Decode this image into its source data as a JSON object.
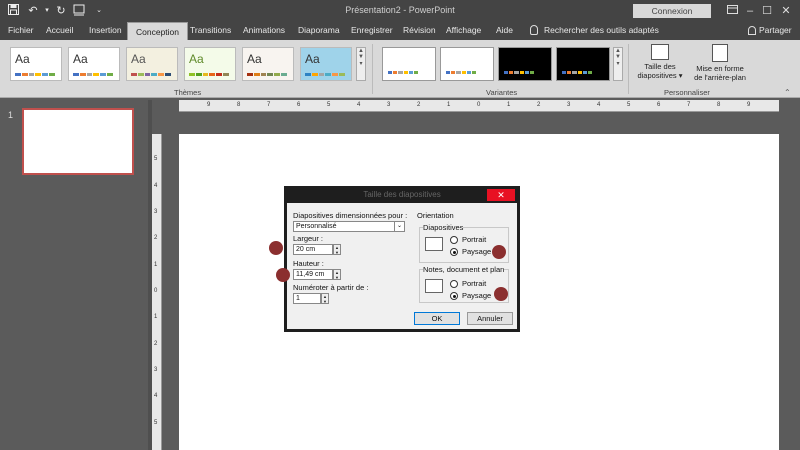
{
  "titlebar": {
    "title": "Présentation2  -  PowerPoint",
    "connexion": "Connexion",
    "icons": [
      "save-icon",
      "undo-icon",
      "redo-icon",
      "touch-mode-icon",
      "customize-icon"
    ],
    "window_controls": [
      "ribbon-display-icon",
      "minimize-icon",
      "restore-icon",
      "close-icon"
    ]
  },
  "tabs": [
    {
      "label": "Fichier",
      "active": false
    },
    {
      "label": "Accueil",
      "active": false
    },
    {
      "label": "Insertion",
      "active": false
    },
    {
      "label": "Conception",
      "active": true
    },
    {
      "label": "Transitions",
      "active": false
    },
    {
      "label": "Animations",
      "active": false
    },
    {
      "label": "Diaporama",
      "active": false
    },
    {
      "label": "Enregistrer",
      "active": false
    },
    {
      "label": "Révision",
      "active": false
    },
    {
      "label": "Affichage",
      "active": false
    },
    {
      "label": "Aide",
      "active": false
    }
  ],
  "search": {
    "label": "Rechercher des outils adaptés",
    "icon": "lightbulb-icon"
  },
  "share": {
    "label": "Partager",
    "icon": "person-icon"
  },
  "ribbon": {
    "themes": {
      "label": "Thèmes",
      "items": [
        {
          "sample": "Aa",
          "bg": "#ffffff",
          "text": "#333333",
          "bars": [
            "#4472c4",
            "#ed7d31",
            "#a5a5a5",
            "#ffc000",
            "#5b9bd5",
            "#70ad47"
          ]
        },
        {
          "sample": "Aa",
          "bg": "#ffffff",
          "text": "#333333",
          "bars": [
            "#4472c4",
            "#ed7d31",
            "#a5a5a5",
            "#ffc000",
            "#5b9bd5",
            "#70ad47"
          ]
        },
        {
          "sample": "Aa",
          "bg": "#f3f0e0",
          "text": "#555555",
          "bars": [
            "#c0504d",
            "#9bbb59",
            "#8064a2",
            "#4bacc6",
            "#f79646",
            "#2c4d75"
          ]
        },
        {
          "sample": "Aa",
          "bg": "#f4fbe9",
          "text": "#5f8a2a",
          "bars": [
            "#90c226",
            "#54a021",
            "#e6b91e",
            "#e76618",
            "#c42f1a",
            "#918655"
          ]
        },
        {
          "sample": "Aa",
          "bg": "#f8f4f0",
          "text": "#333333",
          "bars": [
            "#a53010",
            "#de7e18",
            "#9f8351",
            "#728653",
            "#92aa4c",
            "#6aac91"
          ]
        },
        {
          "sample": "Aa",
          "bg": "#9fd3ea",
          "text": "#333333",
          "bars": [
            "#2e83c3",
            "#ffa500",
            "#a5a5a5",
            "#4bacc6",
            "#f79646",
            "#9bbb59"
          ]
        }
      ]
    },
    "variants": {
      "label": "Variantes",
      "items": [
        {
          "bg": "#ffffff",
          "bars": [
            "#4472c4",
            "#ed7d31",
            "#a5a5a5",
            "#ffc000",
            "#5b9bd5",
            "#70ad47"
          ]
        },
        {
          "bg": "#ffffff",
          "bars": [
            "#4472c4",
            "#ed7d31",
            "#a5a5a5",
            "#ffc000",
            "#5b9bd5",
            "#70ad47"
          ]
        },
        {
          "bg": "#000000",
          "bars": [
            "#4472c4",
            "#ed7d31",
            "#a5a5a5",
            "#ffc000",
            "#5b9bd5",
            "#70ad47"
          ]
        },
        {
          "bg": "#000000",
          "bars": [
            "#4472c4",
            "#ed7d31",
            "#a5a5a5",
            "#ffc000",
            "#5b9bd5",
            "#70ad47"
          ]
        }
      ]
    },
    "customize": {
      "label": "Personnaliser",
      "slide_size_line1": "Taille des",
      "slide_size_line2": "diapositives ▾",
      "bg_format_line1": "Mise en forme",
      "bg_format_line2": "de l'arrière-plan"
    }
  },
  "slides_panel": {
    "number": "1"
  },
  "rulers": {
    "h": [
      "9",
      "8",
      "7",
      "6",
      "5",
      "4",
      "3",
      "2",
      "1",
      "0",
      "1",
      "2",
      "3",
      "4",
      "5",
      "6",
      "7",
      "8",
      "9"
    ],
    "v": [
      "5",
      "4",
      "3",
      "2",
      "1",
      "0",
      "1",
      "2",
      "3",
      "4",
      "5"
    ]
  },
  "dialog": {
    "title": "Taille des diapositives",
    "slides_sized_for_label": "Diapositives dimensionnées pour :",
    "slides_sized_for_value": "Personnalisé",
    "width_label": "Largeur :",
    "width_value": "20 cm",
    "height_label": "Hauteur :",
    "height_value": "11,49 cm",
    "number_from_label": "Numéroter à partir de :",
    "number_from_value": "1",
    "orientation_label": "Orientation",
    "slides_group": "Diapositives",
    "notes_group": "Notes, document et plan",
    "portrait": "Portrait",
    "landscape": "Paysage",
    "slides_orientation": "landscape",
    "notes_orientation": "landscape",
    "ok": "OK",
    "cancel": "Annuler"
  },
  "colors": {
    "accent_marker": "#8b2f2f",
    "active_slide_border": "#c0504d",
    "close_red": "#e81123"
  }
}
